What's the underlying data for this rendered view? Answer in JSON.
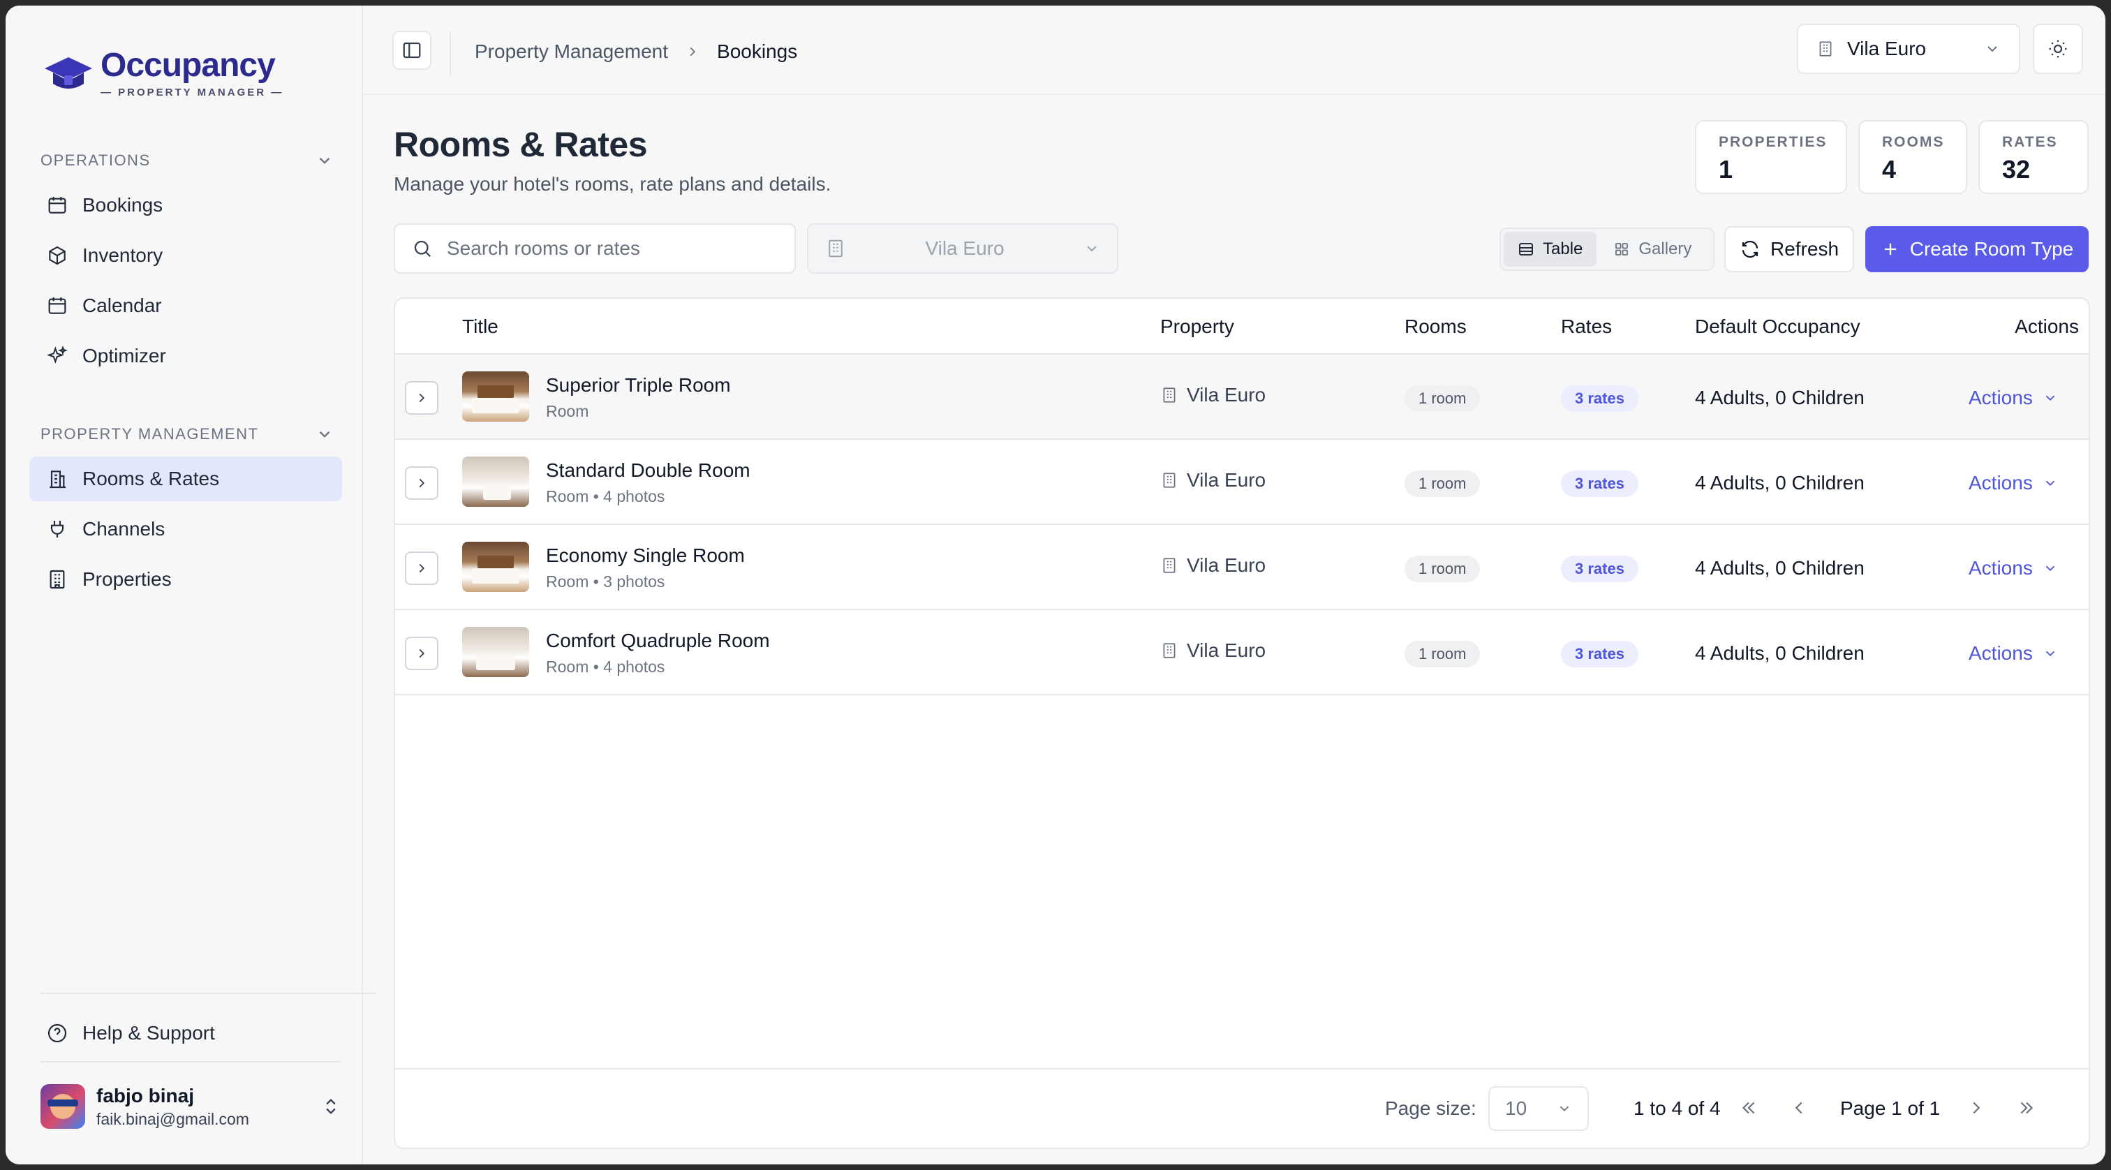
{
  "brand": {
    "name": "Occupancy",
    "tagline": "— PROPERTY MANAGER —"
  },
  "sidebar": {
    "sections": [
      {
        "title": "OPERATIONS",
        "items": [
          {
            "label": "Bookings",
            "icon": "calendar-icon"
          },
          {
            "label": "Inventory",
            "icon": "box-icon"
          },
          {
            "label": "Calendar",
            "icon": "calendar-icon"
          },
          {
            "label": "Optimizer",
            "icon": "sparkles-icon"
          }
        ]
      },
      {
        "title": "PROPERTY MANAGEMENT",
        "items": [
          {
            "label": "Rooms & Rates",
            "icon": "building-icon",
            "active": true
          },
          {
            "label": "Channels",
            "icon": "plug-icon"
          },
          {
            "label": "Properties",
            "icon": "building-icon"
          }
        ]
      }
    ],
    "help": "Help & Support",
    "user": {
      "name": "fabjo binaj",
      "email": "faik.binaj@gmail.com"
    }
  },
  "header": {
    "breadcrumb": [
      "Property Management",
      "Bookings"
    ],
    "property_selector": "Vila Euro"
  },
  "page": {
    "title": "Rooms & Rates",
    "subtitle": "Manage your hotel's rooms, rate plans and details.",
    "stats": [
      {
        "label": "PROPERTIES",
        "value": "1"
      },
      {
        "label": "ROOMS",
        "value": "4"
      },
      {
        "label": "RATES",
        "value": "32"
      }
    ]
  },
  "toolbar": {
    "search_placeholder": "Search rooms or rates",
    "property_filter": "Vila Euro",
    "view_table": "Table",
    "view_gallery": "Gallery",
    "refresh": "Refresh",
    "create": "Create Room Type"
  },
  "table": {
    "columns": [
      "Title",
      "Property",
      "Rooms",
      "Rates",
      "Default Occupancy",
      "Actions"
    ],
    "rows": [
      {
        "title": "Superior Triple Room",
        "sub": "Room",
        "property": "Vila Euro",
        "rooms": "1 room",
        "rates": "3 rates",
        "occupancy": "4 Adults, 0 Children",
        "action": "Actions"
      },
      {
        "title": "Standard Double Room",
        "sub": "Room • 4 photos",
        "property": "Vila Euro",
        "rooms": "1 room",
        "rates": "3 rates",
        "occupancy": "4 Adults, 0 Children",
        "action": "Actions"
      },
      {
        "title": "Economy Single Room",
        "sub": "Room • 3 photos",
        "property": "Vila Euro",
        "rooms": "1 room",
        "rates": "3 rates",
        "occupancy": "4 Adults, 0 Children",
        "action": "Actions"
      },
      {
        "title": "Comfort Quadruple Room",
        "sub": "Room • 4 photos",
        "property": "Vila Euro",
        "rooms": "1 room",
        "rates": "3 rates",
        "occupancy": "4 Adults, 0 Children",
        "action": "Actions"
      }
    ]
  },
  "pagination": {
    "page_size_label": "Page size:",
    "page_size": "10",
    "range": "1 to 4 of 4",
    "page": "Page 1 of 1"
  },
  "colors": {
    "accent": "#5b5bea",
    "brand": "#2d2a8e",
    "link": "#4f55d9"
  }
}
